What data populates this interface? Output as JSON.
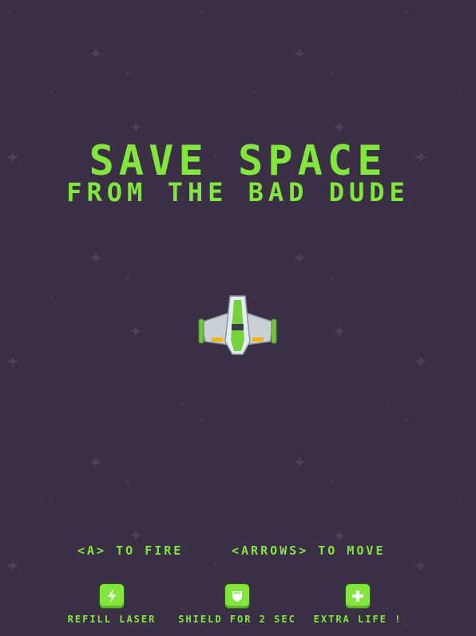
{
  "title": {
    "line1": "SAVE SPACE",
    "line2": "FROM THE BAD DUDE"
  },
  "controls": {
    "fire": "<A> TO FIRE",
    "move": "<ARROWS> TO MOVE"
  },
  "powerups": [
    {
      "icon": "bolt-icon",
      "label": "REFILL LASER"
    },
    {
      "icon": "shield-icon",
      "label": "SHIELD FOR 2 SEC"
    },
    {
      "icon": "plus-icon",
      "label": "EXTRA LIFE !"
    }
  ],
  "colors": {
    "background": "#3b2f45",
    "accent": "#82e63c",
    "star": "#4c405a"
  }
}
